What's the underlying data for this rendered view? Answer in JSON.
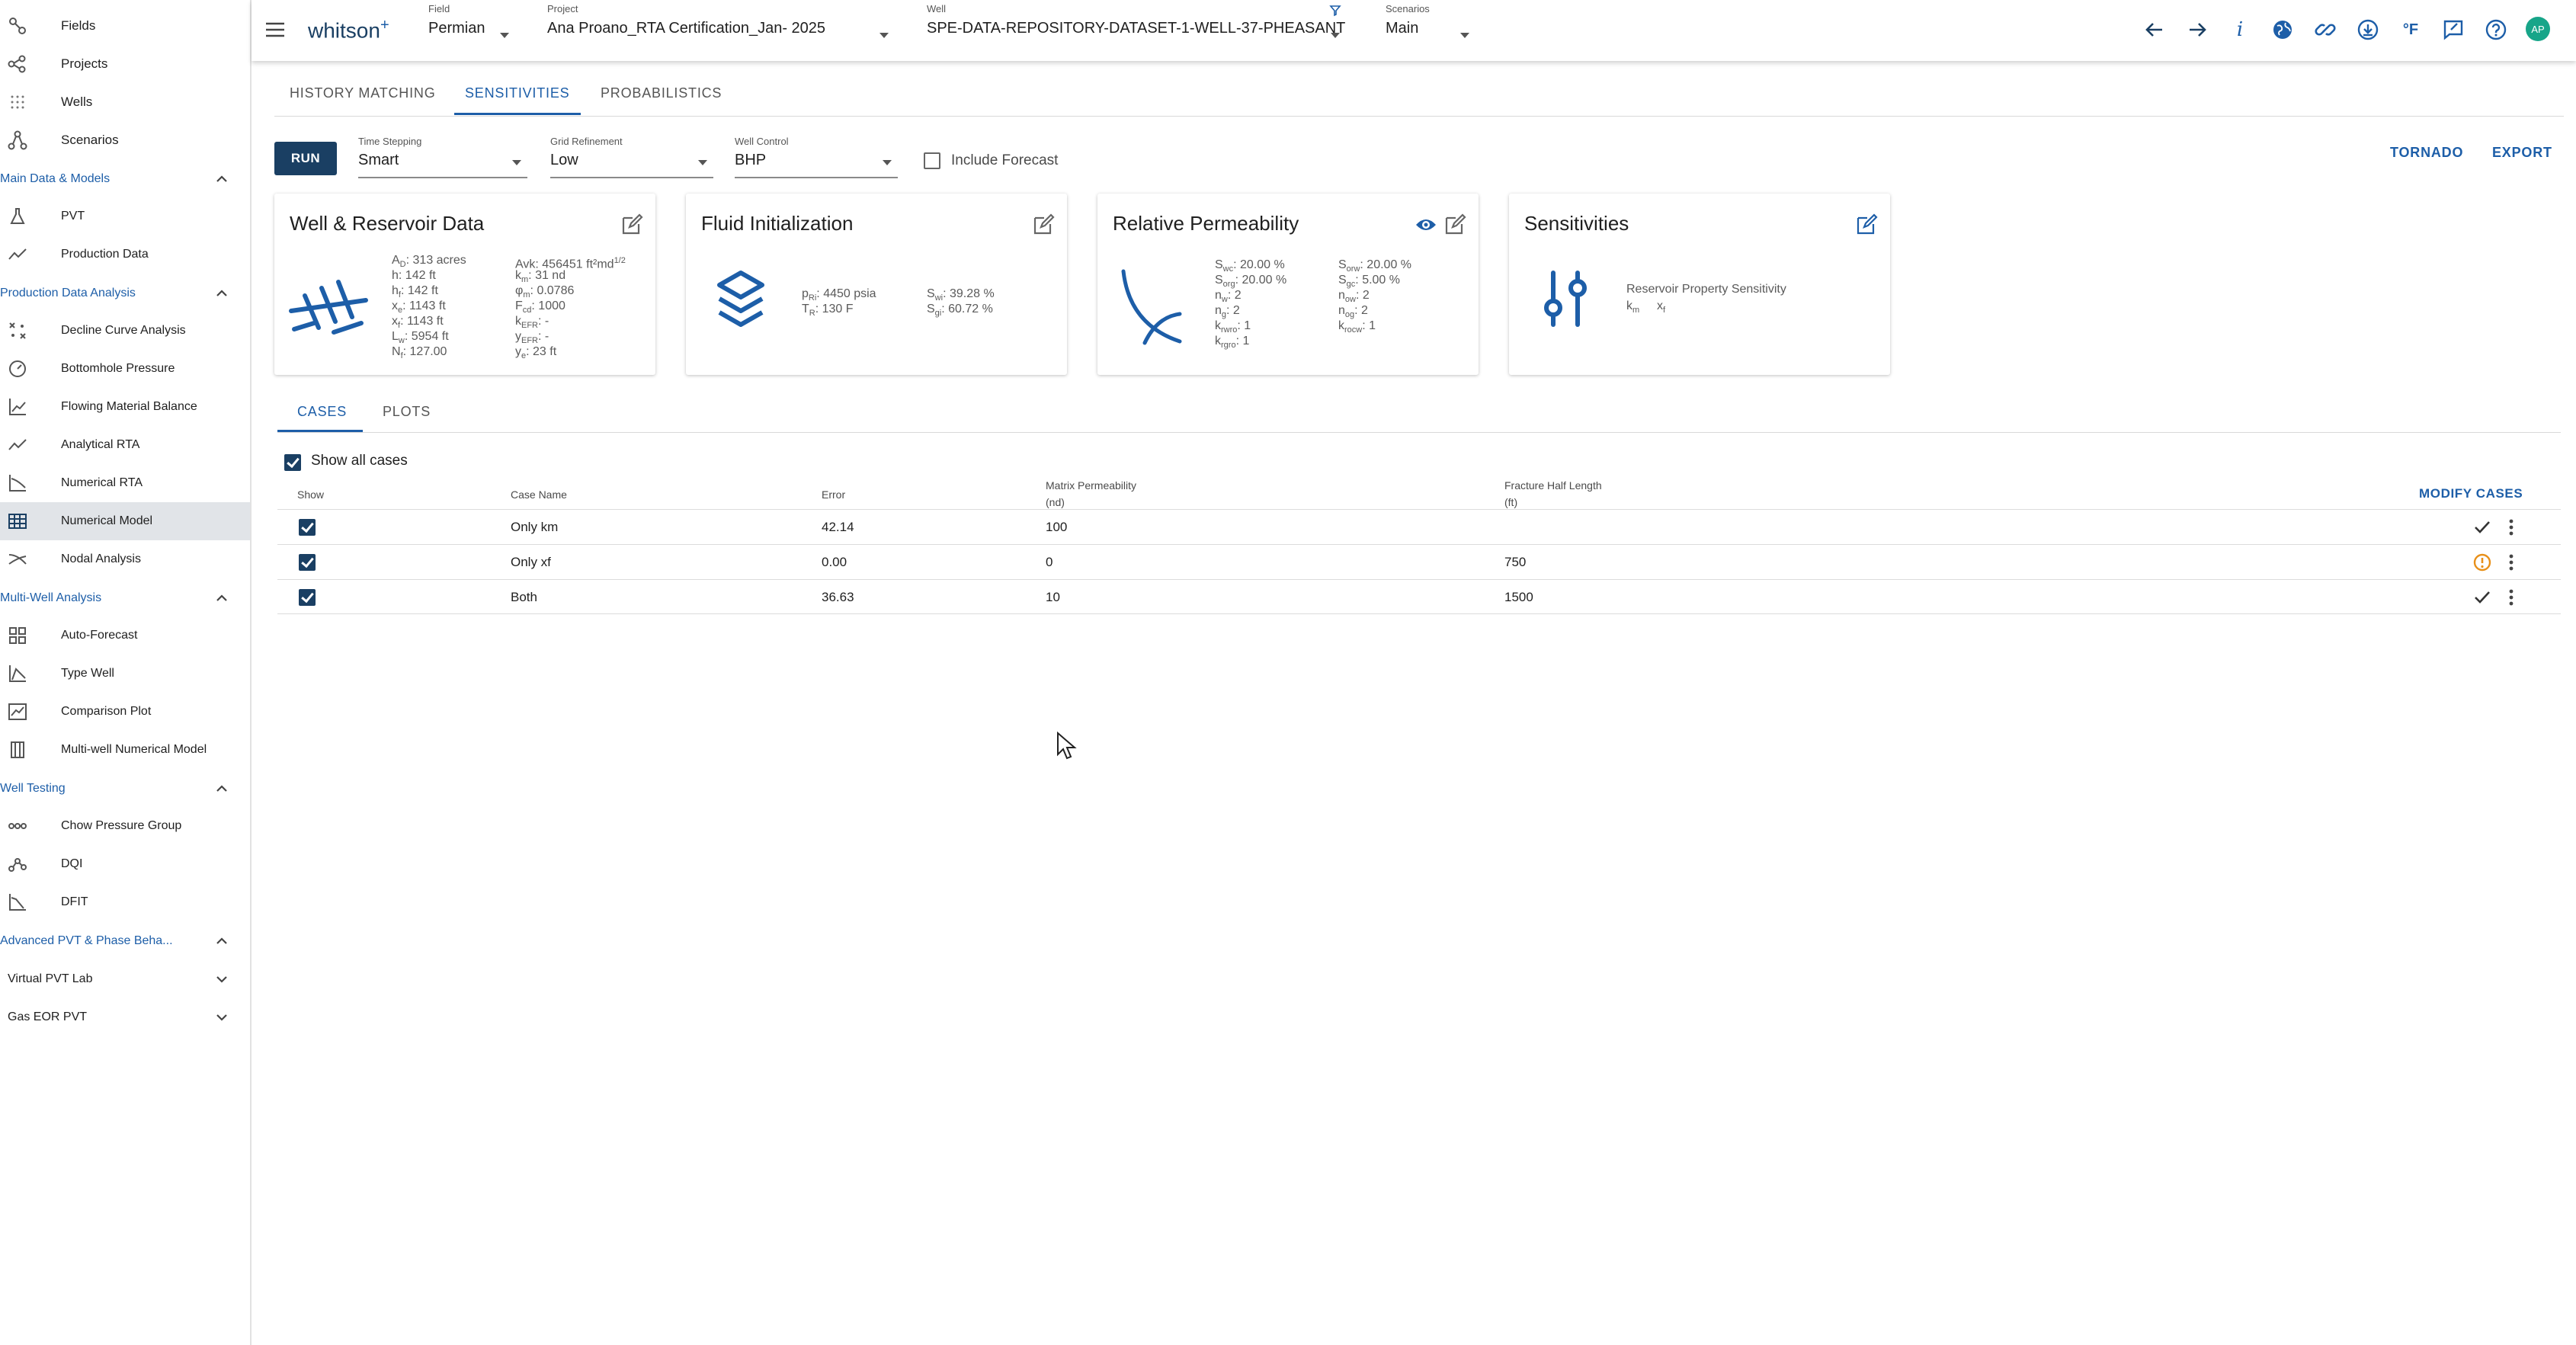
{
  "sidebar": {
    "top_items": [
      {
        "label": "Fields",
        "icon": "fields-icon"
      },
      {
        "label": "Projects",
        "icon": "projects-icon"
      },
      {
        "label": "Wells",
        "icon": "wells-icon"
      },
      {
        "label": "Scenarios",
        "icon": "scenarios-icon"
      }
    ],
    "sections": [
      {
        "title": "Main Data & Models",
        "items": [
          {
            "label": "PVT",
            "icon": "flask-icon"
          },
          {
            "label": "Production Data",
            "icon": "trend-icon"
          }
        ]
      },
      {
        "title": "Production Data Analysis",
        "items": [
          {
            "label": "Decline Curve Analysis",
            "icon": "decline-icon"
          },
          {
            "label": "Bottomhole Pressure",
            "icon": "gauge-icon"
          },
          {
            "label": "Flowing Material Balance",
            "icon": "chart-icon"
          },
          {
            "label": "Analytical RTA",
            "icon": "trend-icon"
          },
          {
            "label": "Numerical RTA",
            "icon": "numerical-chart-icon"
          },
          {
            "label": "Numerical Model",
            "icon": "grid-model-icon",
            "active": true
          },
          {
            "label": "Nodal Analysis",
            "icon": "nodal-icon"
          }
        ]
      },
      {
        "title": "Multi-Well Analysis",
        "items": [
          {
            "label": "Auto-Forecast",
            "icon": "dashboard-icon"
          },
          {
            "label": "Type Well",
            "icon": "type-well-icon"
          },
          {
            "label": "Comparison Plot",
            "icon": "comparison-icon"
          },
          {
            "label": "Multi-well Numerical Model",
            "icon": "columns-icon"
          }
        ]
      },
      {
        "title": "Well Testing",
        "items": [
          {
            "label": "Chow Pressure Group",
            "icon": "dots-line-icon"
          },
          {
            "label": "DQI",
            "icon": "dqi-icon"
          },
          {
            "label": "DFIT",
            "icon": "dfit-icon"
          }
        ]
      },
      {
        "title": "Advanced PVT & Phase Beha...",
        "items": []
      }
    ],
    "collapsed": [
      "Virtual PVT Lab",
      "Gas EOR PVT"
    ]
  },
  "topbar": {
    "logo": "whitson",
    "logo_sup": "+",
    "field": {
      "caption": "Field",
      "value": "Permian"
    },
    "project": {
      "caption": "Project",
      "value": "Ana Proano_RTA Certification_Jan- 2025"
    },
    "well": {
      "caption": "Well",
      "value": "SPE-DATA-REPOSITORY-DATASET-1-WELL-37-PHEASANT"
    },
    "scenarios": {
      "caption": "Scenarios",
      "value": "Main"
    },
    "temp_unit": "°F",
    "avatar": "AP",
    "info": "i"
  },
  "main_tabs": [
    "HISTORY MATCHING",
    "SENSITIVITIES",
    "PROBABILISTICS"
  ],
  "controls": {
    "run": "RUN",
    "time_stepping": {
      "caption": "Time Stepping",
      "value": "Smart"
    },
    "grid_refinement": {
      "caption": "Grid Refinement",
      "value": "Low"
    },
    "well_control": {
      "caption": "Well Control",
      "value": "BHP"
    },
    "include_forecast": "Include Forecast",
    "tornado": "TORNADO",
    "export": "EXPORT"
  },
  "cards": {
    "well": {
      "title": "Well & Reservoir Data",
      "col1": [
        {
          "s": "A",
          "sub": "D",
          "v": "313 acres"
        },
        {
          "s": "h",
          "sub": "",
          "v": "142 ft"
        },
        {
          "s": "h",
          "sub": "f",
          "v": "142 ft"
        },
        {
          "s": "x",
          "sub": "e",
          "v": "1143 ft"
        },
        {
          "s": "x",
          "sub": "f",
          "v": "1143 ft"
        },
        {
          "s": "L",
          "sub": "w",
          "v": "5954 ft"
        },
        {
          "s": "N",
          "sub": "f",
          "v": "127.00"
        }
      ],
      "col2": [
        {
          "s": "Avk",
          "sub": "",
          "v": "456451 ft²md",
          "sup": "1/2"
        },
        {
          "s": "k",
          "sub": "m",
          "v": "31 nd"
        },
        {
          "s": "φ",
          "sub": "m",
          "v": "0.0786"
        },
        {
          "s": "F",
          "sub": "cd",
          "v": "1000"
        },
        {
          "s": "k",
          "sub": "EFR",
          "v": "-"
        },
        {
          "s": "y",
          "sub": "EFR",
          "v": "-"
        },
        {
          "s": "y",
          "sub": "e",
          "v": "23 ft"
        }
      ]
    },
    "fluid": {
      "title": "Fluid Initialization",
      "col1": [
        {
          "s": "p",
          "sub": "Ri",
          "v": "4450 psia"
        },
        {
          "s": "T",
          "sub": "R",
          "v": "130 F"
        }
      ],
      "col2": [
        {
          "s": "S",
          "sub": "wi",
          "v": "39.28 %"
        },
        {
          "s": "S",
          "sub": "gi",
          "v": "60.72 %"
        }
      ]
    },
    "relperm": {
      "title": "Relative Permeability",
      "col1": [
        {
          "s": "S",
          "sub": "wc",
          "v": "20.00 %"
        },
        {
          "s": "S",
          "sub": "org",
          "v": "20.00 %"
        },
        {
          "s": "n",
          "sub": "w",
          "v": "2"
        },
        {
          "s": "n",
          "sub": "g",
          "v": "2"
        },
        {
          "s": "k",
          "sub": "rwro",
          "v": "1"
        },
        {
          "s": "k",
          "sub": "rgro",
          "v": "1"
        }
      ],
      "col2": [
        {
          "s": "S",
          "sub": "orw",
          "v": "20.00 %"
        },
        {
          "s": "S",
          "sub": "gc",
          "v": "5.00 %"
        },
        {
          "s": "n",
          "sub": "ow",
          "v": "2"
        },
        {
          "s": "n",
          "sub": "og",
          "v": "2"
        },
        {
          "s": "k",
          "sub": "rocw",
          "v": "1"
        }
      ]
    },
    "sens": {
      "title": "Sensitivities",
      "desc": "Reservoir Property Sensitivity",
      "params": [
        {
          "s": "k",
          "sub": "m"
        },
        {
          "s": "x",
          "sub": "f"
        }
      ]
    }
  },
  "sub_tabs": [
    "CASES",
    "PLOTS"
  ],
  "table": {
    "show_all": "Show all cases",
    "modify": "MODIFY CASES",
    "headers": {
      "show": "Show",
      "case_name": "Case Name",
      "error": "Error",
      "matrix_perm": "Matrix Permeability",
      "matrix_perm_unit": "(nd)",
      "frac_len": "Fracture Half Length",
      "frac_len_unit": "(ft)"
    },
    "rows": [
      {
        "name": "Only km",
        "error": "42.14",
        "km": "100",
        "xf": "",
        "status": "check-icon"
      },
      {
        "name": "Only xf",
        "error": "0.00",
        "km": "0",
        "xf": "750",
        "status": "warning-icon"
      },
      {
        "name": "Both",
        "error": "36.63",
        "km": "10",
        "xf": "1500",
        "status": "check-icon"
      }
    ]
  },
  "colors": {
    "accent": "#1d5ea8",
    "run": "#1a3f63",
    "warning": "#e8901a",
    "avatar": "#17a589"
  }
}
